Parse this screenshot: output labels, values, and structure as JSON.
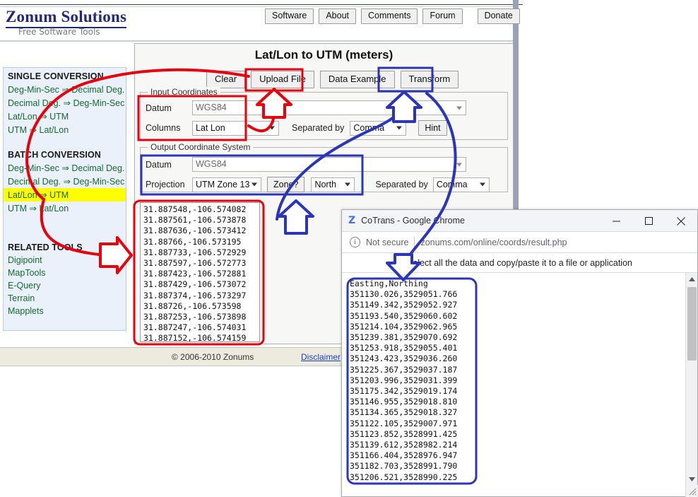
{
  "site": {
    "brand": "Zonum Solutions",
    "tagline": "Free Software Tools",
    "nav": [
      {
        "label": "Software"
      },
      {
        "label": "About"
      },
      {
        "label": "Comments"
      },
      {
        "label": "Forum"
      },
      {
        "label": "Donate"
      }
    ],
    "footer": {
      "copyright": "© 2006-2010 Zonums",
      "disclaimer": "Disclaimer"
    }
  },
  "sidebar": {
    "single_heading": "SINGLE CONVERSION",
    "single_items": [
      {
        "label": "Deg-Min-Sec ⇒ Decimal Deg."
      },
      {
        "label": "Decimal Deg. ⇒ Deg-Min-Sec"
      },
      {
        "label": "Lat/Lon ⇒ UTM"
      },
      {
        "label": "UTM ⇒ Lat/Lon"
      }
    ],
    "batch_heading": "BATCH CONVERSION",
    "batch_items": [
      {
        "label": "Deg-Min-Sec ⇒ Decimal Deg.",
        "active": false
      },
      {
        "label": "Decimal Deg. ⇒ Deg-Min-Sec",
        "active": false
      },
      {
        "label": "Lat/Lon ⇒ UTM",
        "active": true
      },
      {
        "label": "UTM ⇒ Lat/Lon",
        "active": false
      }
    ],
    "related_heading": "RELATED TOOLS",
    "related_items": [
      {
        "label": "Digipoint"
      },
      {
        "label": "MapTools"
      },
      {
        "label": "E-Query"
      },
      {
        "label": "Terrain"
      },
      {
        "label": "Mapplets"
      }
    ]
  },
  "tool": {
    "title": "Lat/Lon to UTM (meters)",
    "actions": [
      {
        "label": "Clear"
      },
      {
        "label": "Upload File"
      },
      {
        "label": "Data Example"
      },
      {
        "label": "Transform"
      }
    ],
    "input_section": {
      "legend": "Input Coordinates",
      "datum_label": "Datum",
      "datum_value": "WGS84",
      "columns_label": "Columns",
      "columns_value": "Lat Lon",
      "separated_label": "Separated by",
      "separated_value": "Comma",
      "hint_label": "Hint"
    },
    "output_section": {
      "legend": "Output Coordinate System",
      "datum_label": "Datum",
      "datum_value": "WGS84",
      "projection_label": "Projection",
      "projection_value": "UTM Zone 13",
      "zone_button": "Zone?",
      "hemisphere_value": "North",
      "separated_label": "Separated by",
      "separated_value": "Comma"
    },
    "input_coordinates": "31.887548,-106.574082\n31.887561,-106.573878\n31.887636,-106.573412\n31.88766,-106.573195\n31.887733,-106.572929\n31.887597,-106.572773\n31.887423,-106.572881\n31.887429,-106.573072\n31.887374,-106.573297\n31.88726,-106.573598\n31.887253,-106.573898\n31.887247,-106.574031\n31.887152,-106.574159"
  },
  "chrome_window": {
    "logo_glyph": "Z",
    "title": "CoTrans - Google Chrome",
    "minimize_icon": "minimize-icon",
    "maximize_icon": "maximize-icon",
    "close_icon": "close-icon",
    "security_label": "Not secure",
    "url": "zonums.com/online/coords/result.php",
    "message": "Select all the data and copy/paste it to a file or application",
    "results": "Easting,Northing\n351130.026,3529051.766\n351149.342,3529052.927\n351193.540,3529060.602\n351214.104,3529062.965\n351239.381,3529070.692\n351253.918,3529055.401\n351243.423,3529036.260\n351225.367,3529037.187\n351203.996,3529031.399\n351175.342,3529019.174\n351146.955,3529018.810\n351134.365,3529018.327\n351122.105,3529007.971\n351123.852,3528991.425\n351139.612,3528982.214\n351166.404,3528976.947\n351182.703,3528991.790\n351206.521,3528990.225"
  },
  "annotations": {
    "red_color": "#e8000d",
    "blue_color": "#2b35b8"
  }
}
